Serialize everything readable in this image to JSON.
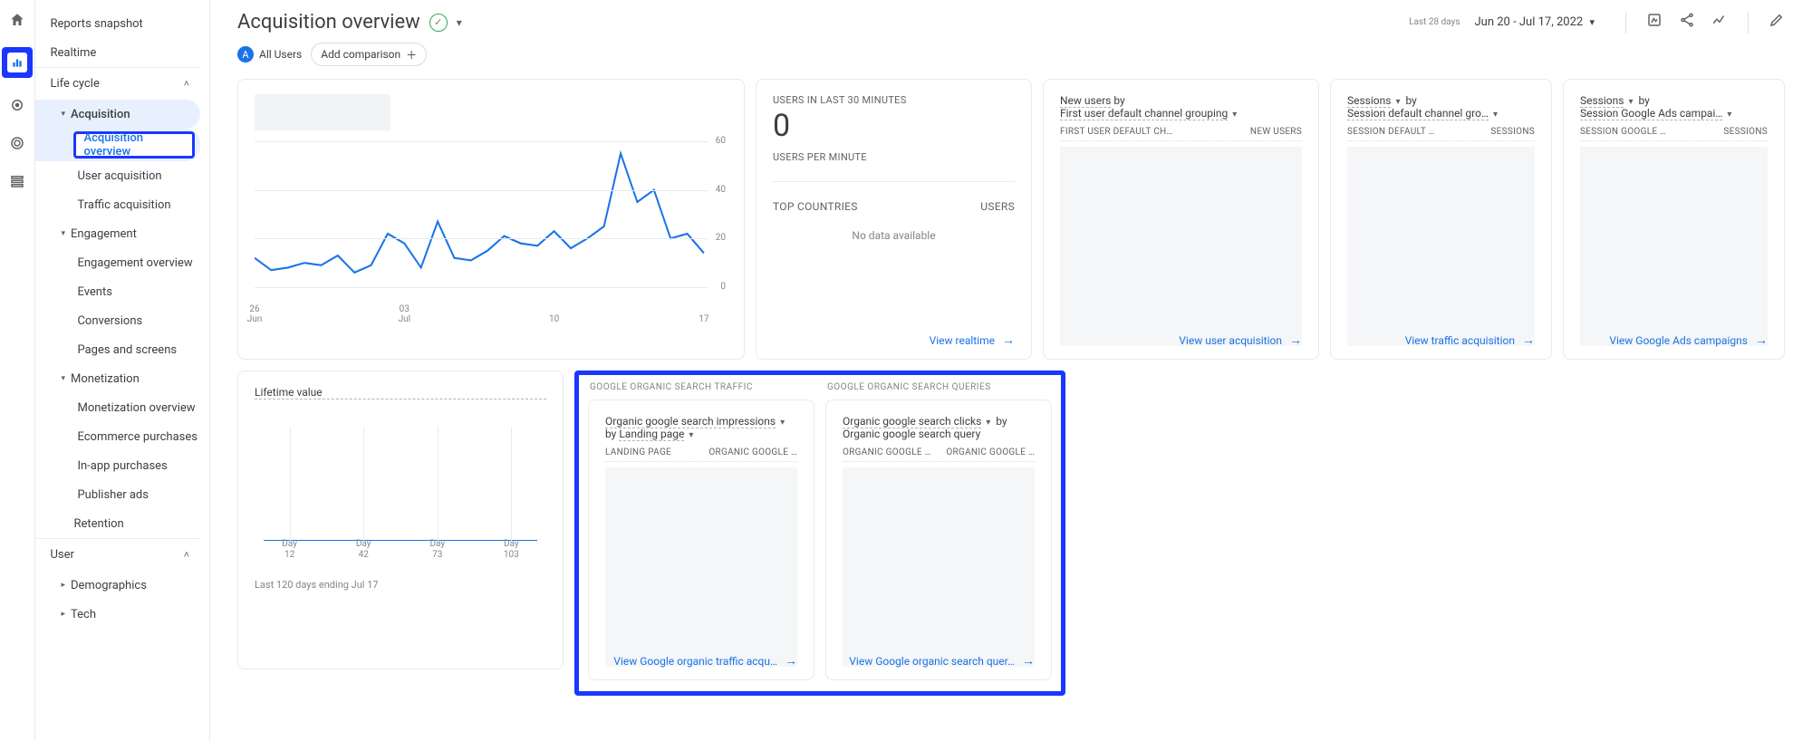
{
  "rail": {
    "items": [
      "home",
      "reports",
      "insights",
      "target",
      "library"
    ]
  },
  "sidebar": {
    "top": [
      "Reports snapshot",
      "Realtime"
    ],
    "sections": {
      "life_cycle": {
        "label": "Life cycle",
        "groups": {
          "acquisition": {
            "label": "Acquisition",
            "items": [
              "Acquisition overview",
              "User acquisition",
              "Traffic acquisition"
            ]
          },
          "engagement": {
            "label": "Engagement",
            "items": [
              "Engagement overview",
              "Events",
              "Conversions",
              "Pages and screens"
            ]
          },
          "monetization": {
            "label": "Monetization",
            "items": [
              "Monetization overview",
              "Ecommerce purchases",
              "In-app purchases",
              "Publisher ads"
            ]
          }
        },
        "retention": "Retention"
      },
      "user": {
        "label": "User",
        "groups": [
          "Demographics",
          "Tech"
        ]
      }
    }
  },
  "header": {
    "title": "Acquisition overview",
    "date_label": "Last 28 days",
    "date_range": "Jun 20 - Jul 17, 2022",
    "all_users_label": "All Users",
    "all_users_badge": "A",
    "add_comparison": "Add comparison"
  },
  "cards": {
    "realtime": {
      "label_top": "Users in last 30 minutes",
      "big": "0",
      "label_mid": "Users per minute",
      "countries_hdr_left": "Top countries",
      "countries_hdr_right": "Users",
      "no_data": "No data available",
      "footer": "View realtime"
    },
    "new_users": {
      "title_a": "New users",
      "by": "by",
      "title_b": "First user default channel grouping",
      "col_left": "First user default ch…",
      "col_right": "New users",
      "footer": "View user acquisition"
    },
    "sessions_channel": {
      "title_a": "Sessions",
      "by": "by",
      "title_b": "Session default channel gro…",
      "col_left": "Session default …",
      "col_right": "Sessions",
      "footer": "View traffic acquisition"
    },
    "sessions_ads": {
      "title_a": "Sessions",
      "by": "by",
      "title_b": "Session Google Ads campai…",
      "col_left": "Session Google …",
      "col_right": "Sessions",
      "footer": "View Google Ads campaigns"
    },
    "lifetime": {
      "title": "Lifetime value",
      "note": "Last 120 days ending Jul 17",
      "xticks": [
        "Day\n12",
        "Day\n42",
        "Day\n73",
        "Day\n103"
      ]
    },
    "search_traffic": {
      "section": "Google organic search traffic",
      "title_a": "Organic google search impressions",
      "line2_by": "by",
      "line2": "Landing page",
      "col_left": "Landing page",
      "col_right": "Organic Google …",
      "footer": "View Google organic traffic acqu…"
    },
    "search_queries": {
      "section": "Google organic search queries",
      "title_a": "Organic google search clicks",
      "by": "by",
      "line2": "Organic google search query",
      "col_left": "Organic Google …",
      "col_right": "Organic Google …",
      "footer": "View Google organic search quer…"
    }
  },
  "chart_data": {
    "type": "line",
    "title": "",
    "xlabel": "",
    "ylabel": "",
    "ylim": [
      0,
      60
    ],
    "yticks": [
      0,
      20,
      40,
      60
    ],
    "xticks": [
      "26\nJun",
      "03\nJul",
      "10",
      "17"
    ],
    "x": [
      0,
      1,
      2,
      3,
      4,
      5,
      6,
      7,
      8,
      9,
      10,
      11,
      12,
      13,
      14,
      15,
      16,
      17,
      18,
      19,
      20,
      21,
      22,
      23,
      24,
      25,
      26,
      27
    ],
    "values": [
      12,
      7,
      8,
      10,
      9,
      13,
      6,
      9,
      22,
      18,
      8,
      27,
      12,
      11,
      15,
      21,
      18,
      17,
      23,
      16,
      20,
      25,
      55,
      35,
      40,
      20,
      22,
      14
    ]
  }
}
